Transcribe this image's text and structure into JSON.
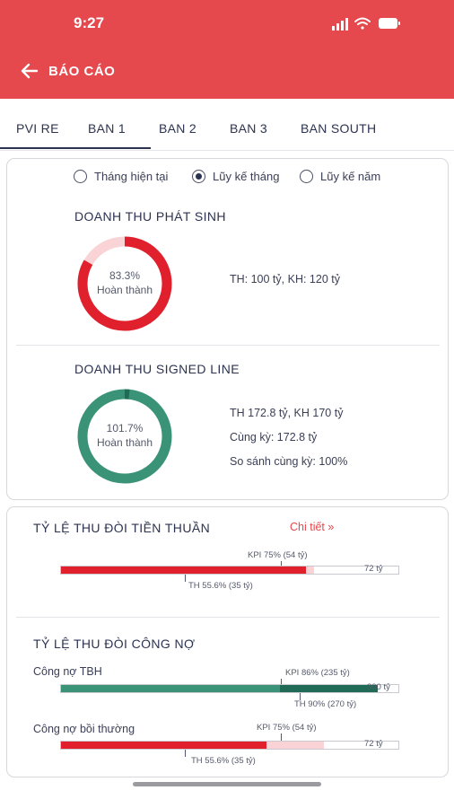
{
  "status_bar": {
    "time": "9:27",
    "icons": [
      "signal-icon",
      "wifi-icon",
      "battery-icon"
    ]
  },
  "header": {
    "title": "BÁO CÁO",
    "back_icon": "arrow-left-icon",
    "background": "#e5484d"
  },
  "tabs": [
    {
      "label": "PVI RE",
      "active": false
    },
    {
      "label": "BAN 1",
      "active": true
    },
    {
      "label": "BAN 2",
      "active": false
    },
    {
      "label": "BAN 3",
      "active": false
    },
    {
      "label": "BAN SOUTH",
      "active": false
    }
  ],
  "period_filter": {
    "options": [
      {
        "label": "Tháng hiện tại",
        "selected": false
      },
      {
        "label": "Lũy kế tháng",
        "selected": true
      },
      {
        "label": "Lũy kế năm",
        "selected": false
      }
    ]
  },
  "revenue_generated": {
    "title": "DOANH THU PHÁT SINH",
    "percent_text": "83.3%",
    "percent_value": 83.3,
    "status": "Hoàn thành",
    "detail": "TH: 100 tỷ, KH: 120 tỷ",
    "color": "#e0202c",
    "track_color": "#f9d3d5"
  },
  "revenue_signed_line": {
    "title": "DOANH THU SIGNED LINE",
    "percent_text": "101.7%",
    "percent_value": 101.7,
    "status": "Hoàn thành",
    "details": [
      "TH 172.8 tỷ, KH 170 tỷ",
      "Cùng kỳ: 172.8 tỷ",
      "So sánh cùng kỳ: 100%"
    ],
    "color": "#3a9277",
    "overflow_color": "#1f6b55"
  },
  "net_collection": {
    "title": "TỶ LỆ THU ĐÒI TIỀN THUẦN",
    "link": "Chi tiết",
    "link_icon": "double-chevron-right-icon",
    "kpi_label": "KPI 75% (54 tỷ)",
    "kpi_value": 75,
    "actual_label": "TH 55.6% (35 tỷ)",
    "actual_value": 72.7,
    "total_label": "72 tỷ",
    "colors": {
      "actual": "#e0202c",
      "kpi": "#f9d3d5"
    }
  },
  "debt_collection": {
    "title": "TỶ LỆ THU ĐÒI CÔNG NỢ",
    "rows": [
      {
        "label": "Công nợ TBH",
        "kpi_label": "KPI 86% (235 tỷ)",
        "kpi_value": 65,
        "actual_label": "TH 90% (270 tỷ)",
        "actual_value": 71,
        "total_label": "300 tỷ",
        "colors": {
          "actual": "#3a9277",
          "extra": "#1f6b55"
        }
      },
      {
        "label": "Công nợ bồi thường",
        "kpi_label": "KPI 75% (54 tỷ)",
        "kpi_value": 78,
        "actual_label": "TH 55.6% (35 tỷ)",
        "actual_value": 61,
        "total_label": "72 tỷ",
        "colors": {
          "actual": "#e0202c",
          "kpi": "#f9d3d5"
        }
      }
    ]
  }
}
